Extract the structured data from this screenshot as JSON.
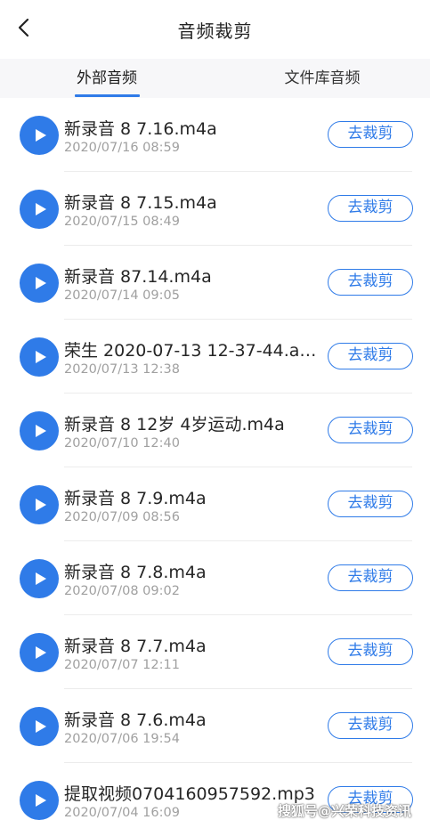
{
  "header": {
    "back_icon": "chevron-left-icon",
    "title": "音频裁剪"
  },
  "tabs": [
    {
      "label": "外部音频",
      "active": true
    },
    {
      "label": "文件库音频",
      "active": false
    }
  ],
  "colors": {
    "accent": "#2f7be8",
    "title_text": "#222222",
    "date_text": "#a0a0a0"
  },
  "files": [
    {
      "name": "新录音 8 7.16.m4a",
      "date": "2020/07/16 08:59",
      "action": "去裁剪"
    },
    {
      "name": "新录音 8 7.15.m4a",
      "date": "2020/07/15 08:49",
      "action": "去裁剪"
    },
    {
      "name": "新录音 87.14.m4a",
      "date": "2020/07/14 09:05",
      "action": "去裁剪"
    },
    {
      "name": "荣生 2020-07-13 12-37-44.a…",
      "date": "2020/07/13 12:38",
      "action": "去裁剪"
    },
    {
      "name": "新录音 8  12岁 4岁运动.m4a",
      "date": "2020/07/10 12:40",
      "action": "去裁剪"
    },
    {
      "name": "新录音 8 7.9.m4a",
      "date": "2020/07/09 08:56",
      "action": "去裁剪"
    },
    {
      "name": "新录音 8 7.8.m4a",
      "date": "2020/07/08 09:02",
      "action": "去裁剪"
    },
    {
      "name": "新录音 8 7.7.m4a",
      "date": "2020/07/07 12:11",
      "action": "去裁剪"
    },
    {
      "name": "新录音 8 7.6.m4a",
      "date": "2020/07/06 19:54",
      "action": "去裁剪"
    },
    {
      "name": "提取视频0704160957592.mp3",
      "date": "2020/07/04 16:09",
      "action": "去裁剪"
    }
  ],
  "watermark": "搜狐号@兴荣科技资讯"
}
